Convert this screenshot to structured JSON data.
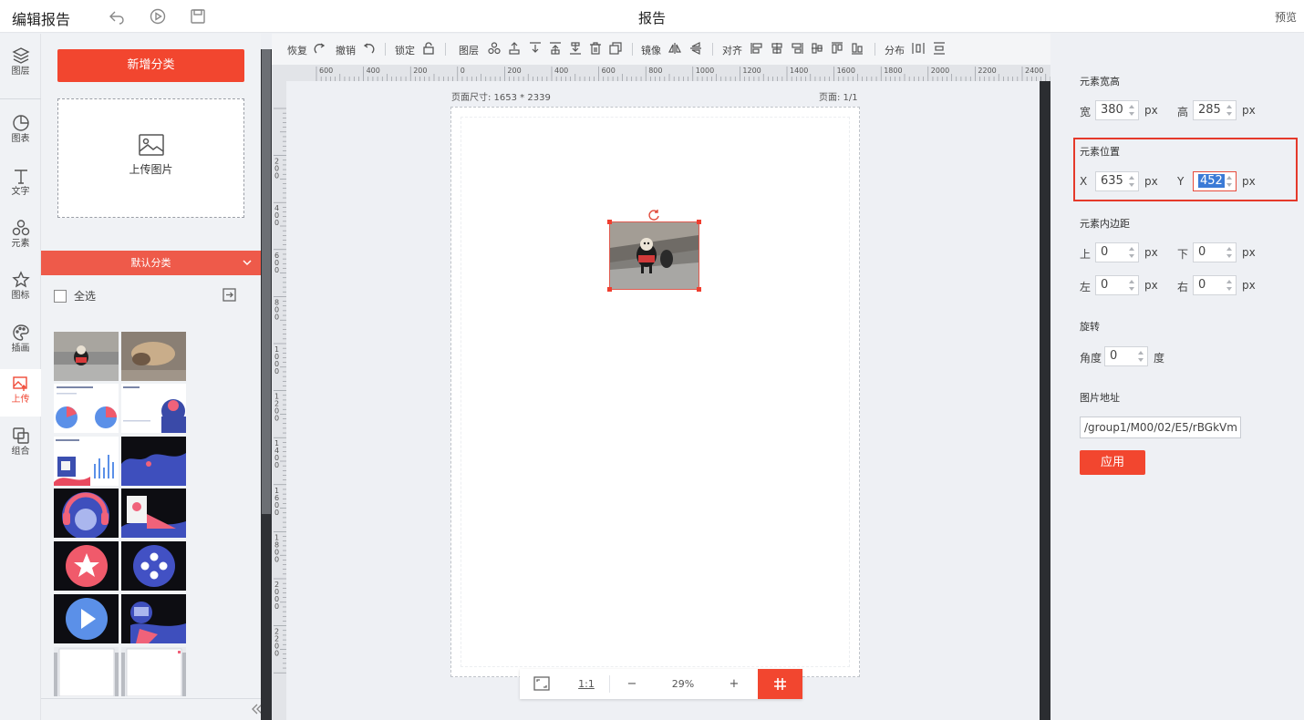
{
  "app": {
    "title": "编辑报告",
    "page_title": "报告",
    "preview": "预览"
  },
  "iconbar": [
    {
      "label": "图层",
      "icon": "layers-icon"
    },
    {
      "label": "图表",
      "icon": "chart-icon"
    },
    {
      "label": "文字",
      "icon": "text-icon"
    },
    {
      "label": "元素",
      "icon": "shapes-icon"
    },
    {
      "label": "图标",
      "icon": "star-icon"
    },
    {
      "label": "插画",
      "icon": "palette-icon"
    },
    {
      "label": "上传",
      "icon": "upload-image-icon",
      "active": true
    },
    {
      "label": "组合",
      "icon": "group-icon"
    }
  ],
  "panel": {
    "add_category": "新增分类",
    "upload": "上传图片",
    "category": "默认分类",
    "select_all": "全选"
  },
  "toolbar": {
    "redo": "恢复",
    "undo": "撤销",
    "lock": "锁定",
    "layer": "图层",
    "mirror": "镜像",
    "align": "对齐",
    "distribute": "分布"
  },
  "ruler": {
    "top_ticks": [
      "600",
      "400",
      "200",
      "0",
      "200",
      "400",
      "600",
      "800",
      "1000",
      "1200",
      "1400",
      "1600",
      "1800",
      "2000",
      "2200",
      "2400"
    ],
    "left_ticks": [
      "200",
      "400",
      "600",
      "800",
      "1000",
      "1200",
      "1400",
      "1600",
      "1800",
      "2000",
      "2200"
    ]
  },
  "canvas": {
    "page_size": "页面尺寸: 1653 * 2339",
    "page_num": "页面: 1/1"
  },
  "zoom": {
    "one_to_one": "1:1",
    "minus": "−",
    "value": "29%",
    "plus": "+"
  },
  "props": {
    "size_title": "元素宽高",
    "width_label": "宽",
    "width": "380",
    "height_label": "高",
    "height": "285",
    "px": "px",
    "pos_title": "元素位置",
    "x_label": "X",
    "x": "635",
    "y_label": "Y",
    "y": "452",
    "padding_title": "元素内边距",
    "top_label": "上",
    "top": "0",
    "bottom_label": "下",
    "bottom": "0",
    "left_label": "左",
    "left": "0",
    "right_label": "右",
    "right": "0",
    "rotate_title": "旋转",
    "angle_label": "角度",
    "angle": "0",
    "degree": "度",
    "url_title": "图片地址",
    "url": "/group1/M00/02/E5/rBGkVm",
    "apply": "应用"
  },
  "colors": {
    "accent": "#f2462f",
    "highlight": "#e5392a"
  }
}
